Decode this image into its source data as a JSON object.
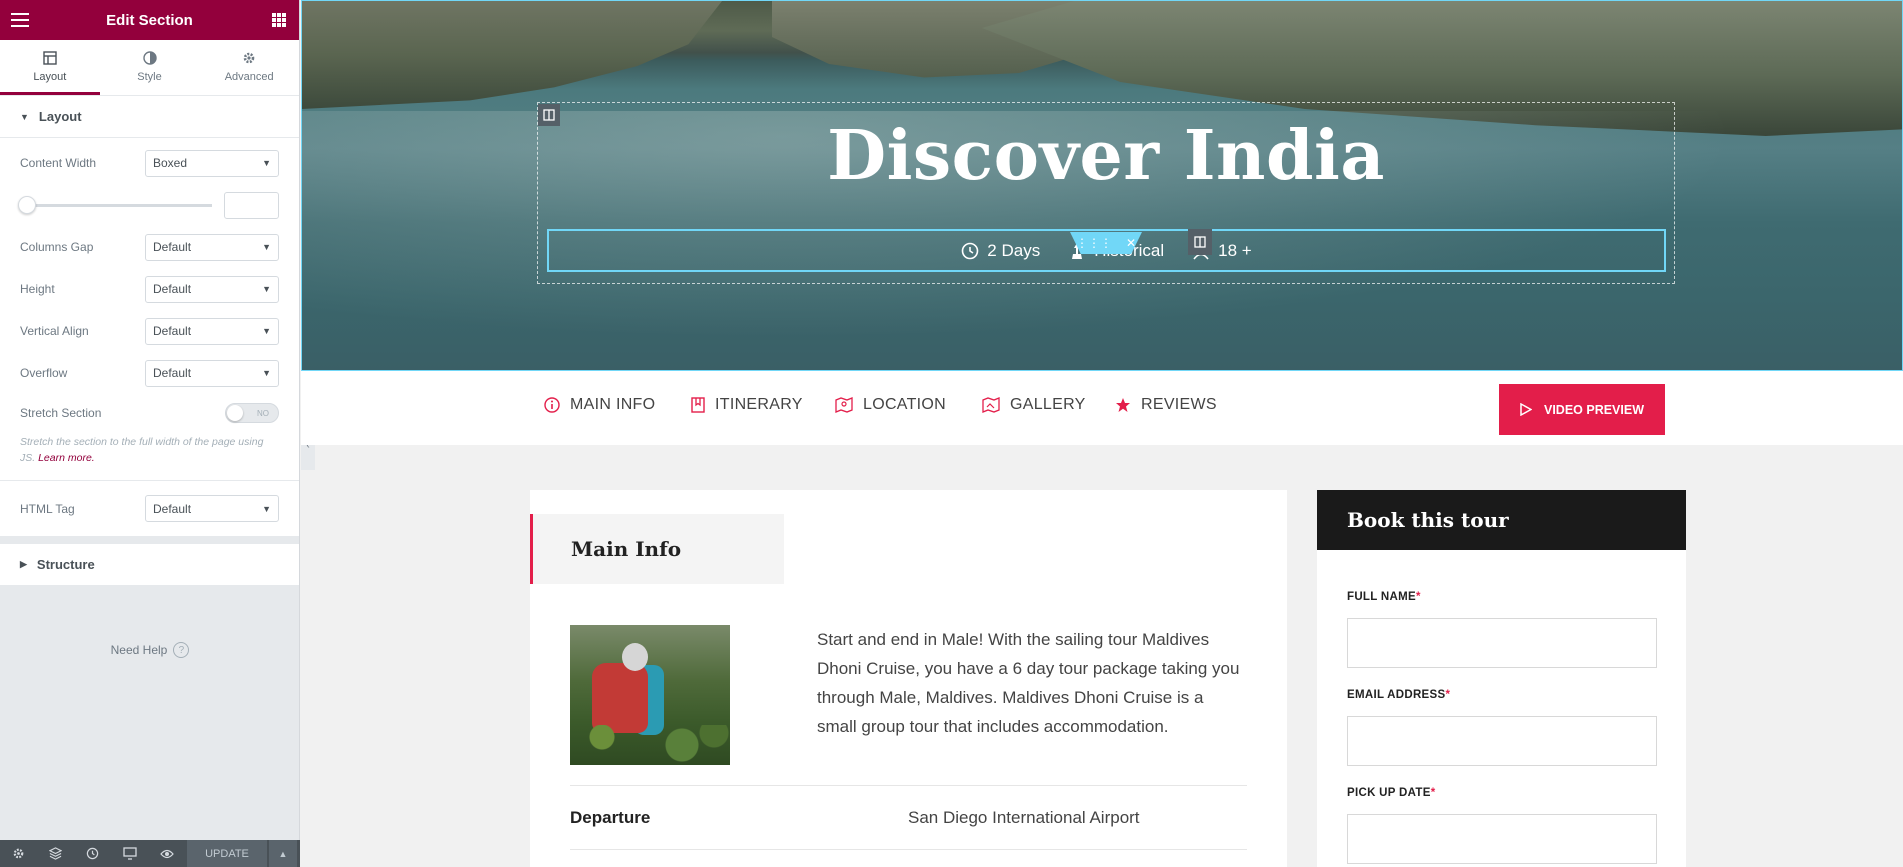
{
  "sidebar": {
    "title": "Edit Section",
    "tabs": [
      {
        "label": "Layout",
        "icon": "layout-icon",
        "active": true
      },
      {
        "label": "Style",
        "icon": "style-icon",
        "active": false
      },
      {
        "label": "Advanced",
        "icon": "gear-icon",
        "active": false
      }
    ],
    "layout_section": "Layout",
    "content_width": {
      "label": "Content Width",
      "value": "Boxed"
    },
    "columns_gap": {
      "label": "Columns Gap",
      "value": "Default"
    },
    "height": {
      "label": "Height",
      "value": "Default"
    },
    "vertical_align": {
      "label": "Vertical Align",
      "value": "Default"
    },
    "overflow": {
      "label": "Overflow",
      "value": "Default"
    },
    "stretch": {
      "label": "Stretch Section",
      "toggle_text": "NO",
      "description": "Stretch the section to the full width of the page using JS.",
      "learn_more": "Learn more."
    },
    "html_tag": {
      "label": "HTML Tag",
      "value": "Default"
    },
    "structure_section": "Structure",
    "need_help": "Need Help",
    "update_label": "UPDATE"
  },
  "hero": {
    "title": "Discover India",
    "meta": [
      {
        "icon": "clock-icon",
        "text": "2 Days"
      },
      {
        "icon": "monument-icon",
        "text": "Historical"
      },
      {
        "icon": "user-icon",
        "text": "18 +"
      }
    ]
  },
  "nav": {
    "items": [
      {
        "icon": "info-icon",
        "label": "MAIN INFO"
      },
      {
        "icon": "bookmark-icon",
        "label": "ITINERARY"
      },
      {
        "icon": "map-icon",
        "label": "LOCATION"
      },
      {
        "icon": "gallery-icon",
        "label": "GALLERY"
      },
      {
        "icon": "star-icon",
        "label": "REVIEWS"
      }
    ],
    "video_button": "VIDEO PREVIEW"
  },
  "main": {
    "title": "Main Info",
    "description": "Start and end in Male! With the sailing tour Maldives Dhoni Cruise, you have a 6 day tour package taking you through Male, Maldives. Maldives Dhoni Cruise is a small group tour that includes accommodation.",
    "departure_label": "Departure",
    "departure_value": "San Diego International Airport"
  },
  "booking": {
    "title": "Book this tour",
    "fields": [
      {
        "label": "FULL NAME",
        "required": "*"
      },
      {
        "label": "EMAIL ADDRESS",
        "required": "*"
      },
      {
        "label": "PICK UP DATE",
        "required": "*"
      }
    ]
  },
  "colors": {
    "brand": "#93003c",
    "accent": "#e31e4a",
    "selection": "#71d7f7"
  }
}
